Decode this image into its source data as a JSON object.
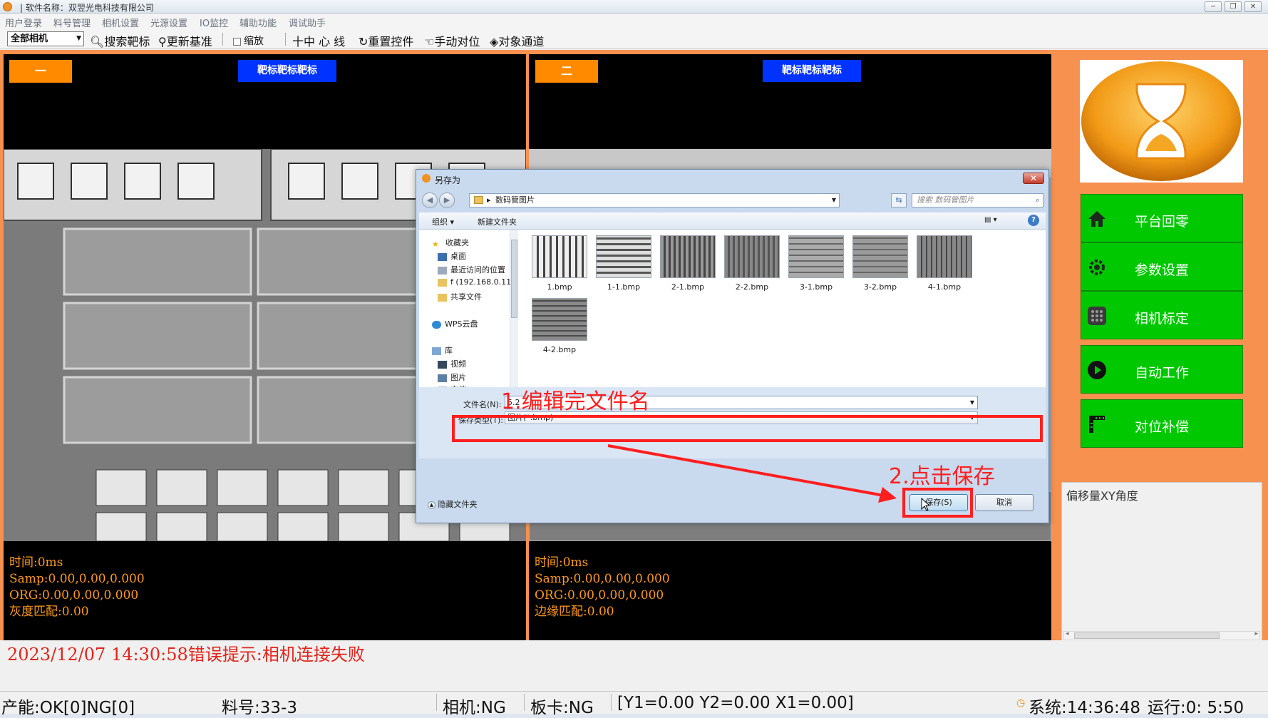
{
  "window": {
    "title": "|  软件名称：双翌光电科技有限公司",
    "controls": [
      "─",
      "❐",
      "✕"
    ]
  },
  "menu": [
    "用户登录",
    "料号管理",
    "相机设置",
    "光源设置",
    "IO监控",
    "辅助功能",
    "调试助手"
  ],
  "toolbar": {
    "camera_select": "全部相机",
    "search_target": "搜索靶标",
    "update_base": "更新基准",
    "zoom": "缩放",
    "crosshair": "十中 心 线",
    "reset_control": "重置控件",
    "manual_align": "手动对位",
    "object_channel": "对象通道"
  },
  "cameras": [
    {
      "label": "一",
      "target_label": "靶标靶标靶标",
      "info": [
        "时间:0ms",
        "Samp:0.00,0.00,0.000",
        "ORG:0.00,0.00,0.000",
        "灰度匹配:0.00"
      ]
    },
    {
      "label": "二",
      "target_label": "靶标靶标靶标",
      "info": [
        "时间:0ms",
        "Samp:0.00,0.00,0.000",
        "ORG:0.00,0.00,0.000",
        "边缘匹配:0.00"
      ]
    }
  ],
  "side": {
    "buttons": [
      "平台回零",
      "参数设置",
      "相机标定",
      "自动工作",
      "对位补偿"
    ],
    "offset_header": "偏移量XY角度"
  },
  "log": "2023/12/07 14:30:58错误提示:相机连接失败",
  "status": {
    "production": "产能:OK[0]NG[0]",
    "part_no": "料号:33-3",
    "camera": "相机:NG",
    "board": "板卡:NG",
    "coords": "[Y1=0.00 Y2=0.00 X1=0.00]",
    "system_time": "系统:14:36:48",
    "runtime": "运行:0: 5:50"
  },
  "dialog": {
    "title": "另存为",
    "close": "✕",
    "address": "数码管图片",
    "search_placeholder": "搜索 数码管图片",
    "organize": "组织 ▾",
    "new_folder": "新建文件夹",
    "tree": [
      {
        "label": "收藏夹",
        "icon": "star"
      },
      {
        "label": "桌面",
        "icon": "desktop"
      },
      {
        "label": "最近访问的位置",
        "icon": "recent"
      },
      {
        "label": "f (192.168.0.11",
        "icon": "folder"
      },
      {
        "label": "共享文件",
        "icon": "folder"
      },
      {
        "label": "WPS云盘",
        "icon": "cloud"
      },
      {
        "label": "库",
        "icon": "library"
      },
      {
        "label": "视频",
        "icon": "video"
      },
      {
        "label": "图片",
        "icon": "picture"
      },
      {
        "label": "文档",
        "icon": "doc"
      }
    ],
    "files": [
      "1.bmp",
      "1-1.bmp",
      "2-1.bmp",
      "2-2.bmp",
      "3-1.bmp",
      "3-2.bmp",
      "4-1.bmp",
      "4-2.bmp"
    ],
    "filename_label": "文件名(N):",
    "filename_value": "5.2",
    "filetype_label": "保存类型(T):",
    "filetype_value": "图片(*.bmp)",
    "hide_folders": "隐藏文件夹",
    "save": "保存(S)",
    "cancel": "取消"
  },
  "annotations": {
    "step1": "1.编辑完文件名",
    "step2": "2.点击保存"
  },
  "colors": {
    "annotation_red": "#ff1f1f",
    "nav_green": "#00c800",
    "main_orange": "#f79150",
    "log_red": "#e3231a",
    "info_orange": "#ff9a1a"
  }
}
